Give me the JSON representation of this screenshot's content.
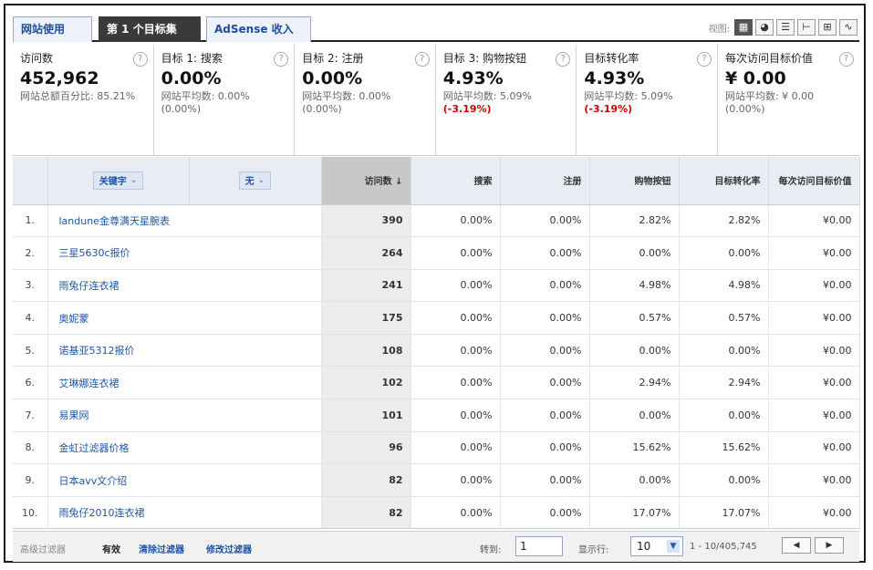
{
  "tabs": [
    {
      "label": "网站使用"
    },
    {
      "label": "第 1 个目标集"
    },
    {
      "label": "AdSense 收入"
    }
  ],
  "view": {
    "label": "视图:"
  },
  "metrics": [
    {
      "name": "访问数",
      "value": "452,962",
      "sub": "网站总额百分比: 85.21%",
      "delta": ""
    },
    {
      "name": "目标 1: 搜索",
      "value": "0.00%",
      "sub": "网站平均数: 0.00% (0.00%)",
      "delta": ""
    },
    {
      "name": "目标 2: 注册",
      "value": "0.00%",
      "sub": "网站平均数: 0.00% (0.00%)",
      "delta": ""
    },
    {
      "name": "目标 3: 购物按钮",
      "value": "4.93%",
      "sub": "网站平均数: 5.09%",
      "delta": "(-3.19%)"
    },
    {
      "name": "目标转化率",
      "value": "4.93%",
      "sub": "网站平均数: 5.09%",
      "delta": "(-3.19%)"
    },
    {
      "name": "每次访问目标价值",
      "value": "¥ 0.00",
      "sub": "网站平均数: ¥ 0.00 (0.00%)",
      "delta": ""
    }
  ],
  "table": {
    "dim_primary": "关键字",
    "dim_secondary": "无",
    "headers": [
      "访问数 ↓",
      "搜索",
      "注册",
      "购物按钮",
      "目标转化率",
      "每次访问目标价值"
    ],
    "rows": [
      {
        "idx": "1.",
        "kw": "landune金尊满天星腕表",
        "visits": "390",
        "search": "0.00%",
        "register": "0.00%",
        "cart": "2.82%",
        "conv": "2.82%",
        "value": "¥0.00"
      },
      {
        "idx": "2.",
        "kw": "三星5630c报价",
        "visits": "264",
        "search": "0.00%",
        "register": "0.00%",
        "cart": "0.00%",
        "conv": "0.00%",
        "value": "¥0.00"
      },
      {
        "idx": "3.",
        "kw": "雨兔仔连衣裙",
        "visits": "241",
        "search": "0.00%",
        "register": "0.00%",
        "cart": "4.98%",
        "conv": "4.98%",
        "value": "¥0.00"
      },
      {
        "idx": "4.",
        "kw": "奥妮蒙",
        "visits": "175",
        "search": "0.00%",
        "register": "0.00%",
        "cart": "0.57%",
        "conv": "0.57%",
        "value": "¥0.00"
      },
      {
        "idx": "5.",
        "kw": "诺基亚5312报价",
        "visits": "108",
        "search": "0.00%",
        "register": "0.00%",
        "cart": "0.00%",
        "conv": "0.00%",
        "value": "¥0.00"
      },
      {
        "idx": "6.",
        "kw": "艾琳娜连衣裙",
        "visits": "102",
        "search": "0.00%",
        "register": "0.00%",
        "cart": "2.94%",
        "conv": "2.94%",
        "value": "¥0.00"
      },
      {
        "idx": "7.",
        "kw": "易果网",
        "visits": "101",
        "search": "0.00%",
        "register": "0.00%",
        "cart": "0.00%",
        "conv": "0.00%",
        "value": "¥0.00"
      },
      {
        "idx": "8.",
        "kw": "金虹过滤器价格",
        "visits": "96",
        "search": "0.00%",
        "register": "0.00%",
        "cart": "15.62%",
        "conv": "15.62%",
        "value": "¥0.00"
      },
      {
        "idx": "9.",
        "kw": "日本avv文介绍",
        "visits": "82",
        "search": "0.00%",
        "register": "0.00%",
        "cart": "0.00%",
        "conv": "0.00%",
        "value": "¥0.00"
      },
      {
        "idx": "10.",
        "kw": "雨兔仔2010连衣裙",
        "visits": "82",
        "search": "0.00%",
        "register": "0.00%",
        "cart": "17.07%",
        "conv": "17.07%",
        "value": "¥0.00"
      }
    ]
  },
  "footer": {
    "advanced_filter": "高级过滤器",
    "status": "有效",
    "clear_filter": "清除过滤器",
    "edit_filter": "修改过滤器",
    "goto_label": "转到:",
    "goto_value": "1",
    "rows_label": "显示行:",
    "rows_value": "10",
    "range": "1 - 10/405,745"
  }
}
